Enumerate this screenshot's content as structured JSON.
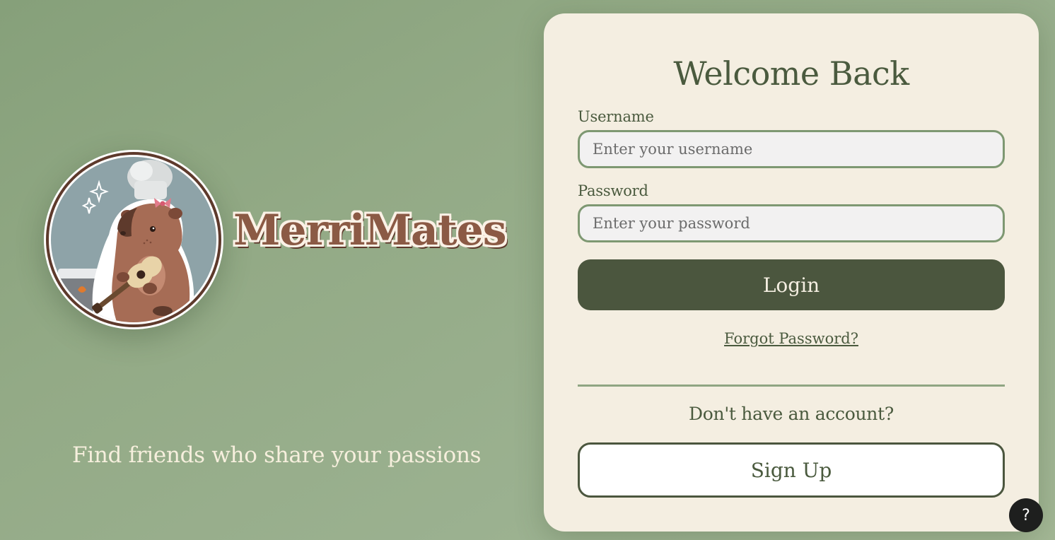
{
  "brand": {
    "name": "MerriMates",
    "tagline": "Find friends who share your passions",
    "logo_icon": "capybara-chef-guitar-logo"
  },
  "login_card": {
    "title": "Welcome Back",
    "username_label": "Username",
    "username_placeholder": "Enter your username",
    "username_value": "",
    "password_label": "Password",
    "password_placeholder": "Enter your password",
    "password_value": "",
    "login_label": "Login",
    "forgot_label": "Forgot Password?",
    "no_account_text": "Don't have an account?",
    "signup_label": "Sign Up"
  },
  "help": {
    "label": "?",
    "icon": "help-icon"
  },
  "colors": {
    "background": "#93aa86",
    "card": "#f4eee1",
    "primary_button": "#4b563e",
    "input_border": "#7e9872",
    "brand": "#8b5a45",
    "text": "#4a5a3e"
  }
}
